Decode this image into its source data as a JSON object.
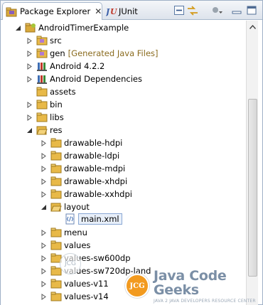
{
  "tabs": [
    {
      "label": "Package Explorer",
      "active": true
    },
    {
      "label": "JUnit",
      "active": false
    }
  ],
  "toolbar": {
    "icons": [
      "collapse-all-icon",
      "link-with-editor-icon",
      "view-menu-icon",
      "minimize-icon",
      "maximize-icon"
    ]
  },
  "tree": {
    "project": "AndroidTimerExample",
    "items": [
      {
        "label": "src",
        "decoration": ""
      },
      {
        "label": "gen",
        "decoration": "[Generated Java Files]"
      },
      {
        "label": "Android 4.2.2",
        "decoration": ""
      },
      {
        "label": "Android Dependencies",
        "decoration": ""
      },
      {
        "label": "assets",
        "decoration": ""
      },
      {
        "label": "bin",
        "decoration": ""
      },
      {
        "label": "libs",
        "decoration": ""
      },
      {
        "label": "res",
        "decoration": ""
      }
    ],
    "res_children": [
      {
        "label": "drawable-hdpi"
      },
      {
        "label": "drawable-ldpi"
      },
      {
        "label": "drawable-mdpi"
      },
      {
        "label": "drawable-xhdpi"
      },
      {
        "label": "drawable-xxhdpi"
      },
      {
        "label": "layout"
      },
      {
        "label": "main.xml"
      },
      {
        "label": "menu"
      },
      {
        "label": "values"
      },
      {
        "label": "values-sw600dp"
      },
      {
        "label": "values-sw720dp-land"
      },
      {
        "label": "values-v11"
      },
      {
        "label": "values-v14"
      }
    ]
  },
  "watermark": {
    "title": "Java Code Geeks",
    "subtitle": "JAVA 2 JAVA DEVELOPERS RESOURCE CENTER",
    "logo": "JCG"
  },
  "colors": {
    "folder": "#e8b948",
    "accent": "#8aa8d4",
    "watermark": "#f29a1f"
  }
}
